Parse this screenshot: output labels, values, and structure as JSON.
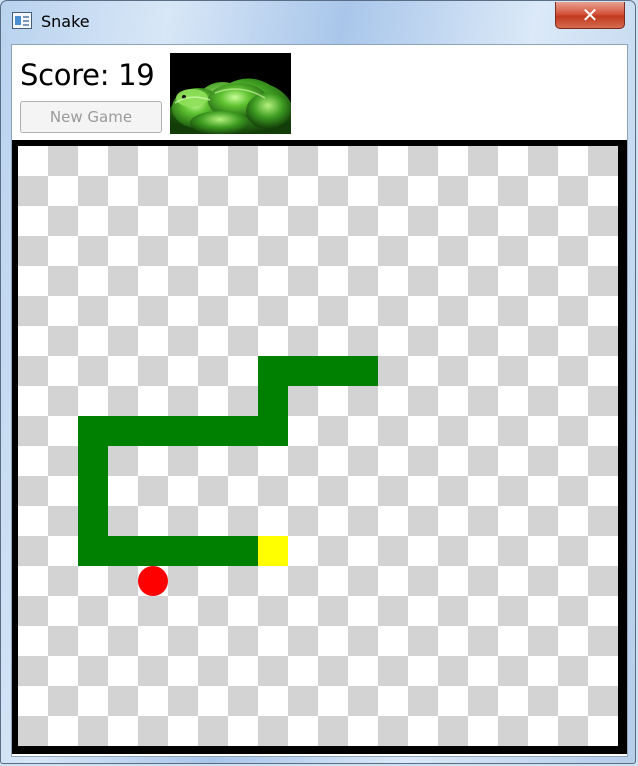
{
  "window": {
    "title": "Snake",
    "close_label": "✕"
  },
  "header": {
    "score_label": "Score:",
    "score": 19,
    "new_game_label": "New Game"
  },
  "board": {
    "columns": 20,
    "rows": 20,
    "checker_colors": [
      "#d3d3d3",
      "#ffffff"
    ],
    "snake_color": "#008000",
    "head_color": "#ffff00",
    "food_color": "#ff0000",
    "snake": [
      [
        8,
        13
      ],
      [
        7,
        13
      ],
      [
        6,
        13
      ],
      [
        5,
        13
      ],
      [
        4,
        13
      ],
      [
        3,
        13
      ],
      [
        2,
        13
      ],
      [
        2,
        12
      ],
      [
        2,
        11
      ],
      [
        2,
        10
      ],
      [
        2,
        9
      ],
      [
        3,
        9
      ],
      [
        4,
        9
      ],
      [
        5,
        9
      ],
      [
        6,
        9
      ],
      [
        7,
        9
      ],
      [
        8,
        9
      ],
      [
        8,
        8
      ],
      [
        8,
        7
      ],
      [
        9,
        7
      ],
      [
        10,
        7
      ],
      [
        11,
        7
      ]
    ],
    "food": [
      4,
      14
    ]
  }
}
